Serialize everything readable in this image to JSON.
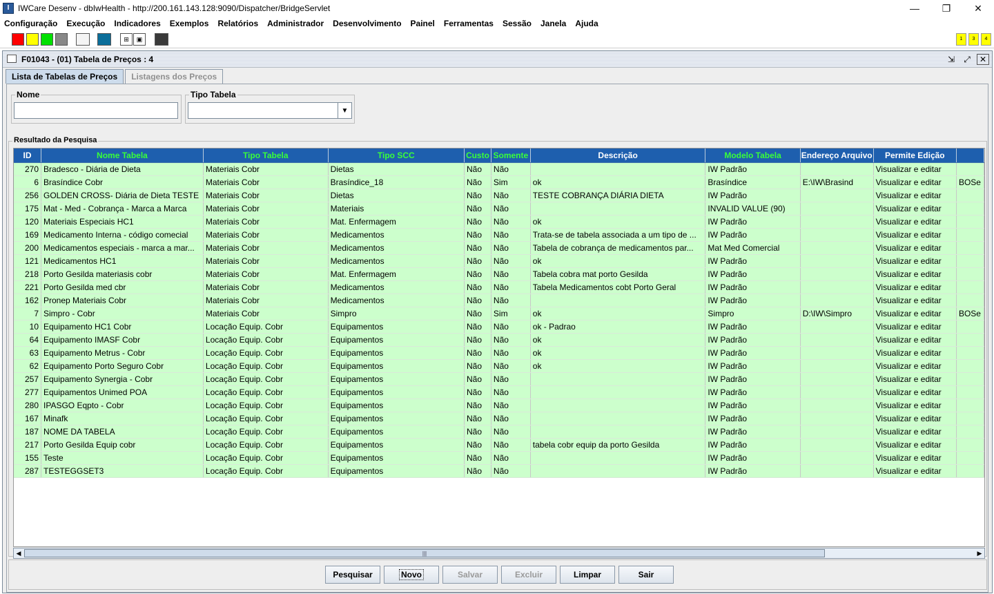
{
  "app": {
    "window_title": "IWCare Desenv - dbIwHealth - http://200.161.143.128:9090/Dispatcher/BridgeServlet",
    "app_icon": "app-logo-icon",
    "window_buttons": {
      "minimize": "—",
      "restore": "❐",
      "close": "✕"
    }
  },
  "menu": {
    "items": [
      "Configuração",
      "Execução",
      "Indicadores",
      "Exemplos",
      "Relatórios",
      "Administrador",
      "Desenvolvimento",
      "Painel",
      "Ferramentas",
      "Sessão",
      "Janela",
      "Ajuda"
    ]
  },
  "toolbar": {
    "swatches": [
      "#ff0000",
      "#ffff00",
      "#00e000",
      "#888888",
      "#f4f4f4",
      "#0b6e9a",
      "#3a3a3a"
    ],
    "indicators": [
      "1",
      "3",
      "4"
    ]
  },
  "frame": {
    "title": "F01043 - (01) Tabela de Preços : 4",
    "buttons": {
      "minimize": "⇲",
      "maximize": "⤢",
      "close": "✕"
    }
  },
  "tabs": [
    {
      "label": "Lista de Tabelas de Preços",
      "active": true
    },
    {
      "label": "Listagens dos Preços",
      "active": false
    }
  ],
  "filters": {
    "nome": {
      "label": "Nome",
      "value": ""
    },
    "tipo": {
      "label": "Tipo Tabela",
      "value": ""
    }
  },
  "results": {
    "title": "Resultado da Pesquisa",
    "columns": [
      "ID",
      "Nome Tabela",
      "Tipo Tabela",
      "Tipo SCC",
      "Custo",
      "Somente",
      "Descrição",
      "Modelo Tabela",
      "Endereço Arquivo",
      "Permite Edição",
      ""
    ],
    "rows": [
      [
        "270",
        "Bradesco - Diária de Dieta",
        "Materiais Cobr",
        "Dietas",
        "Não",
        "Não",
        "",
        "IW Padrão",
        "",
        "Visualizar e editar",
        ""
      ],
      [
        "6",
        "Brasíndice Cobr",
        "Materiais Cobr",
        "Brasíndice_18",
        "Não",
        "Sim",
        "ok",
        "Brasíndice",
        "E:\\IW\\Brasind",
        "Visualizar e editar",
        "BOSe"
      ],
      [
        "256",
        "GOLDEN CROSS- Diária de Dieta TESTE",
        "Materiais Cobr",
        "Dietas",
        "Não",
        "Não",
        "TESTE COBRANÇA DIÁRIA DIETA",
        "IW Padrão",
        "",
        "Visualizar e editar",
        ""
      ],
      [
        "175",
        "Mat - Med - Cobrança - Marca a Marca",
        "Materiais Cobr",
        "Materiais",
        "Não",
        "Não",
        "",
        "INVALID VALUE (90)",
        "",
        "Visualizar e editar",
        ""
      ],
      [
        "120",
        "Materiais Especiais HC1",
        "Materiais Cobr",
        "Mat. Enfermagem",
        "Não",
        "Não",
        "ok",
        "IW Padrão",
        "",
        "Visualizar e editar",
        ""
      ],
      [
        "169",
        "Medicamento  Interna - código comecial",
        "Materiais Cobr",
        "Medicamentos",
        "Não",
        "Não",
        "Trata-se de  tabela associada a um tipo de ...",
        "IW Padrão",
        "",
        "Visualizar e editar",
        ""
      ],
      [
        "200",
        "Medicamentos especiais - marca a mar...",
        "Materiais Cobr",
        "Medicamentos",
        "Não",
        "Não",
        "Tabela de cobrança de medicamentos par...",
        "Mat Med Comercial",
        "",
        "Visualizar e editar",
        ""
      ],
      [
        "121",
        "Medicamentos HC1",
        "Materiais Cobr",
        "Medicamentos",
        "Não",
        "Não",
        "ok",
        "IW Padrão",
        "",
        "Visualizar e editar",
        ""
      ],
      [
        "218",
        "Porto Gesilda materiasis cobr",
        "Materiais Cobr",
        "Mat. Enfermagem",
        "Não",
        "Não",
        "Tabela cobra mat porto Gesilda",
        "IW Padrão",
        "",
        "Visualizar e editar",
        ""
      ],
      [
        "221",
        "Porto Gesilda med cbr",
        "Materiais Cobr",
        "Medicamentos",
        "Não",
        "Não",
        "Tabela Medicamentos cobt Porto Geral",
        "IW Padrão",
        "",
        "Visualizar e editar",
        ""
      ],
      [
        "162",
        "Pronep Materiais Cobr",
        "Materiais Cobr",
        "Medicamentos",
        "Não",
        "Não",
        "",
        "IW Padrão",
        "",
        "Visualizar e editar",
        ""
      ],
      [
        "7",
        "Simpro - Cobr",
        "Materiais Cobr",
        "Simpro",
        "Não",
        "Sim",
        "ok",
        "Simpro",
        "D:\\IW\\Simpro",
        "Visualizar e editar",
        "BOSe"
      ],
      [
        "10",
        "Equipamento HC1 Cobr",
        "Locação Equip. Cobr",
        "Equipamentos",
        "Não",
        "Não",
        "ok - Padrao",
        "IW Padrão",
        "",
        "Visualizar e editar",
        ""
      ],
      [
        "64",
        "Equipamento IMASF  Cobr",
        "Locação Equip. Cobr",
        "Equipamentos",
        "Não",
        "Não",
        "ok",
        "IW Padrão",
        "",
        "Visualizar e editar",
        ""
      ],
      [
        "63",
        "Equipamento Metrus - Cobr",
        "Locação Equip. Cobr",
        "Equipamentos",
        "Não",
        "Não",
        "ok",
        "IW Padrão",
        "",
        "Visualizar e editar",
        ""
      ],
      [
        "62",
        "Equipamento Porto Seguro Cobr",
        "Locação Equip. Cobr",
        "Equipamentos",
        "Não",
        "Não",
        "ok",
        "IW Padrão",
        "",
        "Visualizar e editar",
        ""
      ],
      [
        "257",
        "Equipamento Synergia - Cobr",
        "Locação Equip. Cobr",
        "Equipamentos",
        "Não",
        "Não",
        "",
        "IW Padrão",
        "",
        "Visualizar e editar",
        ""
      ],
      [
        "277",
        "Equipamentos Unimed POA",
        "Locação Equip. Cobr",
        "Equipamentos",
        "Não",
        "Não",
        "",
        "IW Padrão",
        "",
        "Visualizar e editar",
        ""
      ],
      [
        "280",
        "IPASGO  Eqpto - Cobr",
        "Locação Equip. Cobr",
        "Equipamentos",
        "Não",
        "Não",
        "",
        "IW Padrão",
        "",
        "Visualizar e editar",
        ""
      ],
      [
        "167",
        "Minafk",
        "Locação Equip. Cobr",
        "Equipamentos",
        "Não",
        "Não",
        "",
        "IW Padrão",
        "",
        "Visualizar e editar",
        ""
      ],
      [
        "187",
        "NOME DA TABELA",
        "Locação Equip. Cobr",
        "Equipamentos",
        "Não",
        "Não",
        "",
        "IW Padrão",
        "",
        "Visualizar e editar",
        ""
      ],
      [
        "217",
        "Porto Gesilda Equip cobr",
        "Locação Equip. Cobr",
        "Equipamentos",
        "Não",
        "Não",
        "tabela cobr equip da porto Gesilda",
        "IW Padrão",
        "",
        "Visualizar e editar",
        ""
      ],
      [
        "155",
        "Teste",
        "Locação Equip. Cobr",
        "Equipamentos",
        "Não",
        "Não",
        "",
        "IW Padrão",
        "",
        "Visualizar e editar",
        ""
      ],
      [
        "287",
        "TESTEGGSET3",
        "Locação Equip. Cobr",
        "Equipamentos",
        "Não",
        "Não",
        "",
        "IW Padrão",
        "",
        "Visualizar e editar",
        ""
      ]
    ]
  },
  "buttons": {
    "pesquisar": "Pesquisar",
    "novo": "Novo",
    "salvar": "Salvar",
    "excluir": "Excluir",
    "limpar": "Limpar",
    "sair": "Sair"
  }
}
